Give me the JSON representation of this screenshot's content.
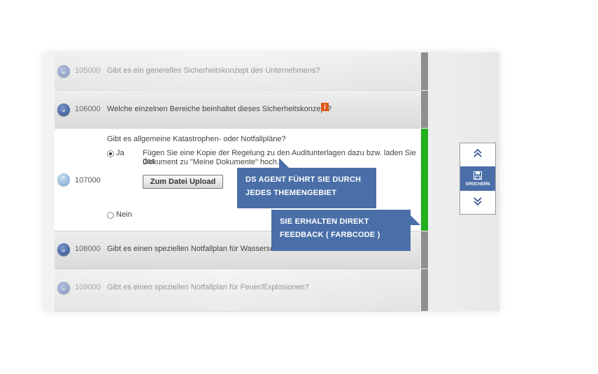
{
  "questions": [
    {
      "number": "105000",
      "text": "Gibt es ein generelles Sicherheitskonzept des Unternehmens?"
    },
    {
      "number": "106000",
      "text": "Welche einzelnen Bereiche beinhaltet dieses Sicherheitskonzept?"
    },
    {
      "number": "107000",
      "text": "Gibt es allgemeine Katastrophen- oder Notfallpläne?"
    },
    {
      "number": "108000",
      "text": "Gibt es einen speziellen Notfallplan für Wasserschäden?"
    },
    {
      "number": "109000",
      "text": "Gibt es einen speziellen Notfallplan für Feuer/Explosionen?"
    }
  ],
  "expanded": {
    "option_yes": "Ja",
    "option_no": "Nein",
    "instruction_line1": "Fügen Sie eine Kopie der Regelung zu den Auditunterlagen dazu bzw. laden Sie das",
    "instruction_line2": "Dokument zu \"Meine Dokumente\" hoch.",
    "upload_button": "Zum Datei Upload",
    "selected": "Ja"
  },
  "callouts": {
    "first_line1": "DS AGENT FÜHRT SIE DURCH",
    "first_line2": "JEDES THEMENGEBIET",
    "second_line1": "SIE ERHALTEN DIREKT",
    "second_line2": "FEEDBACK ( FARBCODE )"
  },
  "side_panel": {
    "save_label": "SPEICHERN"
  },
  "icons": {
    "info": "i",
    "collapse": "chevron-down-icon",
    "expand": "chevron-up-icon"
  },
  "colors": {
    "accent": "#4a6fa8",
    "status_ok": "#22b01c",
    "status_neutral": "#8f8f8f",
    "info_icon": "#e2581c"
  }
}
